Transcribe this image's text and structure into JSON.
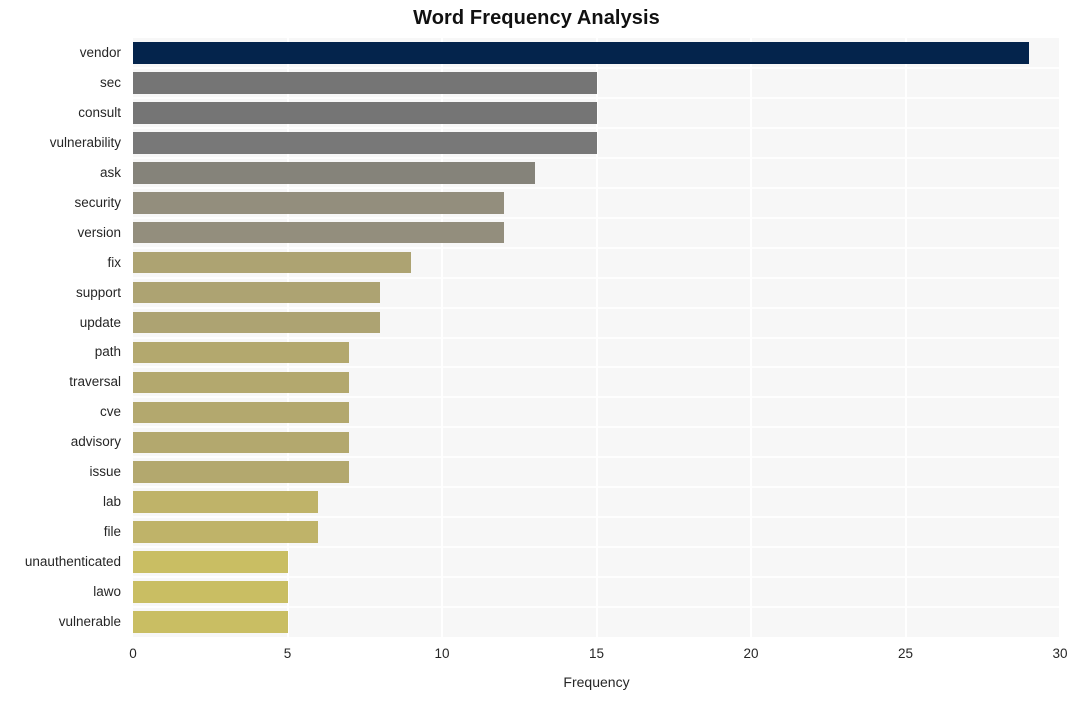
{
  "chart_data": {
    "type": "bar",
    "orientation": "horizontal",
    "title": "Word Frequency Analysis",
    "xlabel": "Frequency",
    "ylabel": "",
    "xlim": [
      0,
      30
    ],
    "ylim": null,
    "grid": true,
    "legend": null,
    "xticks": [
      0,
      5,
      10,
      15,
      20,
      25,
      30
    ],
    "xtick_labels": [
      "0",
      "5",
      "10",
      "15",
      "20",
      "25",
      "30"
    ],
    "categories": [
      "vendor",
      "sec",
      "consult",
      "vulnerability",
      "ask",
      "security",
      "version",
      "fix",
      "support",
      "update",
      "path",
      "traversal",
      "cve",
      "advisory",
      "issue",
      "lab",
      "file",
      "unauthenticated",
      "lawo",
      "vulnerable"
    ],
    "values": [
      29,
      15,
      15,
      15,
      13,
      12,
      12,
      9,
      8,
      8,
      7,
      7,
      7,
      7,
      7,
      6,
      6,
      5,
      5,
      5
    ],
    "bar_colors": [
      "#04244c",
      "#757575",
      "#757575",
      "#787878",
      "#85837a",
      "#938e7d",
      "#938e7d",
      "#ada372",
      "#ada372",
      "#ada372",
      "#b3a86e",
      "#b3a86e",
      "#b3a86e",
      "#b3a86e",
      "#b3a86e",
      "#bfb369",
      "#bfb369",
      "#c9be63",
      "#c9be63",
      "#c9be63"
    ],
    "plot_background": "#f7f7f7",
    "figure_background": "#ffffff",
    "gridline_color": "#ffffff",
    "text_color": "#262626",
    "title_color": "#111111"
  }
}
